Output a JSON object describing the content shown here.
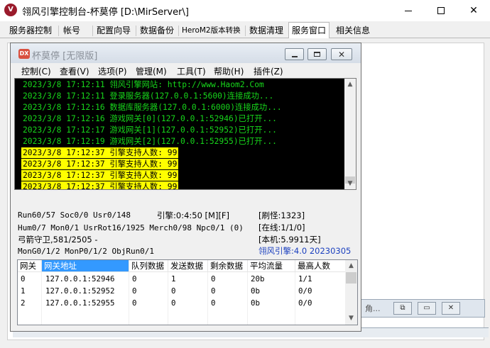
{
  "window": {
    "icon_letter": "V",
    "title": "翎风引擎控制台-杯莫停 [D:\\MirServer\\]"
  },
  "tabs": [
    {
      "label": "服务器控制"
    },
    {
      "label": "帐号"
    },
    {
      "label": "配置向导"
    },
    {
      "label": "数据备份"
    },
    {
      "label": "HeroM2版本转换"
    },
    {
      "label": "数据清理"
    },
    {
      "label": "服务窗口",
      "active": true
    },
    {
      "label": "相关信息"
    }
  ],
  "background_window": {
    "title": "角...",
    "icons": [
      "restore-icon",
      "maximize-icon",
      "close-icon"
    ]
  },
  "inner_window": {
    "icon_text": "DX",
    "title": "杯莫停 [无限版]",
    "menu": [
      "控制(C)",
      "查看(V)",
      "选项(P)",
      "管理(M)",
      "工具(T)",
      "帮助(H)",
      "插件(Z)"
    ]
  },
  "log": [
    {
      "text": "2023/3/8 17:12:11 翎风引擎网站: http://www.Haom2.Com",
      "highlight": false
    },
    {
      "text": "2023/3/8 17:12:11 登录服务器(127.0.0.1:5600)连接成功...",
      "highlight": false
    },
    {
      "text": "2023/3/8 17:12:16 数据库服务器(127.0.0.1:6000)连接成功...",
      "highlight": false
    },
    {
      "text": "2023/3/8 17:12:16 游戏网关[0](127.0.0.1:52946)已打开...",
      "highlight": false
    },
    {
      "text": "2023/3/8 17:12:17 游戏网关[1](127.0.0.1:52952)已打开...",
      "highlight": false
    },
    {
      "text": "2023/3/8 17:12:19 游戏网关[2](127.0.0.1:52955)已打开...",
      "highlight": false
    },
    {
      "text": "2023/3/8 17:12:37 引擎支持人数: 99",
      "highlight": true
    },
    {
      "text": "2023/3/8 17:12:37 引擎支持人数: 99",
      "highlight": true
    },
    {
      "text": "2023/3/8 17:12:37 引擎支持人数: 99",
      "highlight": true
    },
    {
      "text": "2023/3/8 17:12:37 引擎支持人数: 99",
      "highlight": true
    }
  ],
  "stats": {
    "run": "Run60/57 Soc0/0 Usr0/148",
    "engine": "引擎:0:4:50 [M][F]",
    "refresh": "[刷怪:1323]",
    "hum": "Hum0/7 Mon0/1 UsrRot16/1925 Merch0/98 Npc0/1 (0)",
    "online": "[在线:1/1/0]",
    "guard": "弓箭守卫,581/2505 -",
    "local": "[本机:5.9911天]",
    "mon": "MonG0/1/2 MonP0/1/2 ObjRun0/1",
    "version": "翎风引擎:4.0 20230305"
  },
  "gateway_table": {
    "headers": [
      "网关",
      "网关地址",
      "队列数据",
      "发送数据",
      "剩余数据",
      "平均流量",
      "最高人数"
    ],
    "rows": [
      [
        "0",
        "127.0.0.1:52946",
        "0",
        "1",
        "0",
        "20b",
        "1/1"
      ],
      [
        "1",
        "127.0.0.1:52952",
        "0",
        "0",
        "0",
        "0b",
        "0/0"
      ],
      [
        "2",
        "127.0.0.1:52955",
        "0",
        "0",
        "0",
        "0b",
        "0/0"
      ]
    ]
  }
}
